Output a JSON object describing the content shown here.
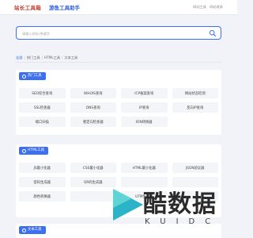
{
  "header": {
    "logo_text": "站长工具箱",
    "site_title": "游鱼工具助手",
    "links": [
      "网站工具",
      "网站收录"
    ]
  },
  "search": {
    "placeholder": "请输入网址/关键字"
  },
  "breadcrumb": {
    "items": [
      "全部",
      "热门工具",
      "HTML工具",
      "文本工具"
    ]
  },
  "sections": [
    {
      "title": "热门工具",
      "tools": [
        "SEO综合查询",
        "WHOIS查询",
        "ICP备案查询",
        "网站状态检测",
        "SSL检查器",
        "DNS查询",
        "IP查询",
        "反向IP查询",
        "端口扫描",
        "重定向检查器",
        "IDN转换器"
      ]
    },
    {
      "title": "HTML工具",
      "tools": [
        "JS最小化器",
        "CSS最小化器",
        "HTML最小化器",
        "JSON验证器",
        "密码生成器",
        "QR码生成器",
        "",
        "",
        "颜色转换器",
        "",
        "UTM生成器",
        ""
      ]
    },
    {
      "title": "文本工具",
      "tools": []
    }
  ],
  "watermark": {
    "chinese": "酷数据",
    "letters": "KUIDC"
  },
  "colors": {
    "accent": "#3d6ff1",
    "logo_red": "#c0392b"
  }
}
